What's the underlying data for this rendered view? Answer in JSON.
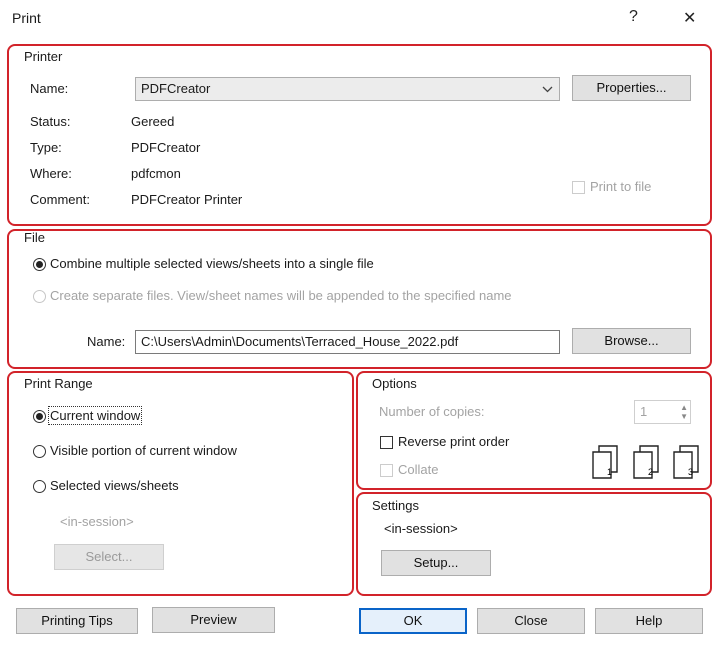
{
  "window": {
    "title": "Print",
    "help_glyph": "?",
    "close_glyph": "✕"
  },
  "printer": {
    "group_label": "Printer",
    "name_label": "Name:",
    "name_value": "PDFCreator",
    "properties_button": "Properties...",
    "status_label": "Status:",
    "status_value": "Gereed",
    "type_label": "Type:",
    "type_value": "PDFCreator",
    "where_label": "Where:",
    "where_value": "pdfcmon",
    "comment_label": "Comment:",
    "comment_value": "PDFCreator Printer",
    "print_to_file_label": "Print to file",
    "print_to_file_checked": false
  },
  "file": {
    "group_label": "File",
    "combine_option": "Combine multiple selected views/sheets into a single file",
    "separate_option": "Create separate files. View/sheet names will be appended to the specified name",
    "selected_option": "combine",
    "name_label": "Name:",
    "name_value": "C:\\Users\\Admin\\Documents\\Terraced_House_2022.pdf",
    "browse_button": "Browse..."
  },
  "print_range": {
    "group_label": "Print Range",
    "current_window": "Current window",
    "visible_portion": "Visible portion of current window",
    "selected_views": "Selected views/sheets",
    "selected_option": "current_window",
    "in_session": "<in-session>",
    "select_button": "Select..."
  },
  "options": {
    "group_label": "Options",
    "copies_label": "Number of copies:",
    "copies_value": "1",
    "reverse_order_label": "Reverse print order",
    "reverse_order_checked": false,
    "collate_label": "Collate",
    "collate_checked": false,
    "collate_icons": [
      "1",
      "2",
      "3"
    ]
  },
  "settings": {
    "group_label": "Settings",
    "value": "<in-session>",
    "setup_button": "Setup..."
  },
  "footer": {
    "printing_tips": "Printing Tips",
    "preview": "Preview",
    "ok": "OK",
    "close": "Close",
    "help": "Help"
  },
  "colors": {
    "highlight_border": "#d2232a",
    "default_button_border": "#0a64c8"
  }
}
